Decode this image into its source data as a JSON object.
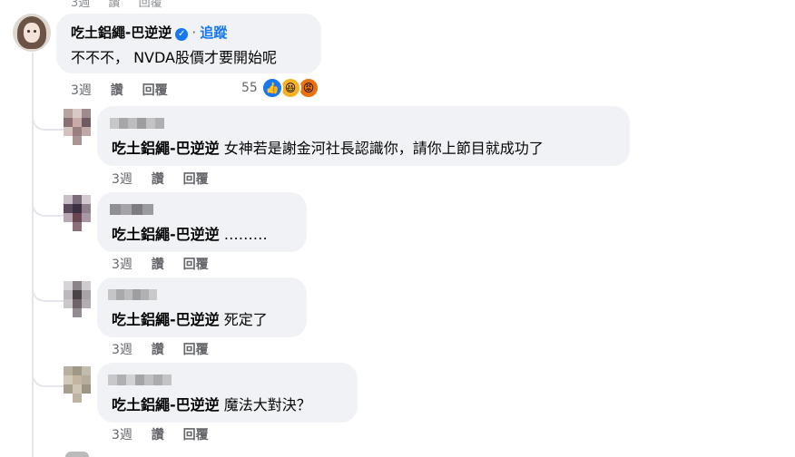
{
  "top_cut": {
    "time": "3週",
    "like": "讚",
    "reply": "回覆"
  },
  "main_comment": {
    "author": "吃土鋁繩-巴逆逆",
    "follow": "追蹤",
    "follow_dot": "·",
    "text": "不不不， NVDA股價才要開始呢",
    "time": "3週",
    "like": "讚",
    "reply": "回覆",
    "reaction_count": "55",
    "reactions": [
      "like-icon",
      "haha-icon",
      "angry-icon"
    ]
  },
  "replies": [
    {
      "mention": "吃土鋁繩-巴逆逆",
      "text": "女神若是謝金河社長認識你，請你上節目就成功了",
      "time": "3週",
      "like": "讚",
      "reply": "回覆"
    },
    {
      "mention": "吃土鋁繩-巴逆逆",
      "text": "………",
      "time": "3週",
      "like": "讚",
      "reply": "回覆"
    },
    {
      "mention": "吃土鋁繩-巴逆逆",
      "text": "死定了",
      "time": "3週",
      "like": "讚",
      "reply": "回覆"
    },
    {
      "mention": "吃土鋁繩-巴逆逆",
      "text": "魔法大對決？",
      "time": "3週",
      "like": "讚",
      "reply": "回覆"
    }
  ],
  "colors": {
    "link": "#1877f2",
    "bubble": "#f0f2f5",
    "meta": "#65676b"
  }
}
